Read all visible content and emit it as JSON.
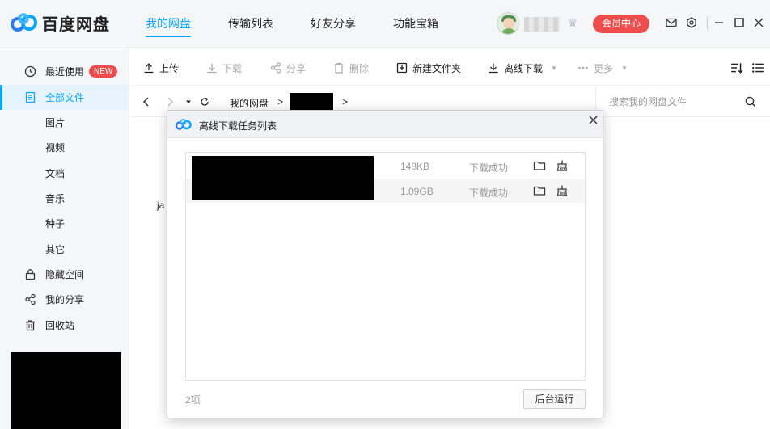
{
  "app": {
    "name": "百度网盘"
  },
  "nav": {
    "tabs": [
      {
        "label": "我的网盘"
      },
      {
        "label": "传输列表"
      },
      {
        "label": "好友分享"
      },
      {
        "label": "功能宝箱"
      }
    ]
  },
  "header": {
    "vip_label": "会员中心"
  },
  "sidebar": {
    "items": [
      {
        "label": "最近使用",
        "badge": "NEW"
      },
      {
        "label": "全部文件"
      },
      {
        "label": "图片"
      },
      {
        "label": "视频"
      },
      {
        "label": "文档"
      },
      {
        "label": "音乐"
      },
      {
        "label": "种子"
      },
      {
        "label": "其它"
      },
      {
        "label": "隐藏空间"
      },
      {
        "label": "我的分享"
      },
      {
        "label": "回收站"
      }
    ]
  },
  "toolbar": {
    "upload": "上传",
    "download": "下载",
    "share": "分享",
    "delete": "删除",
    "new_folder": "新建文件夹",
    "offline_download": "离线下载",
    "more": "更多"
  },
  "breadcrumb": {
    "root": "我的网盘",
    "sep": ">"
  },
  "search": {
    "placeholder": "搜索我的网盘文件"
  },
  "background_text": "ja",
  "dialog": {
    "title": "离线下载任务列表",
    "tasks": [
      {
        "size": "148KB",
        "status": "下载成功"
      },
      {
        "size": "1.09GB",
        "status": "下载成功"
      }
    ],
    "count": "2项",
    "run_background": "后台运行"
  },
  "colors": {
    "accent": "#06a7ff",
    "vip": "#ef4d4d"
  }
}
